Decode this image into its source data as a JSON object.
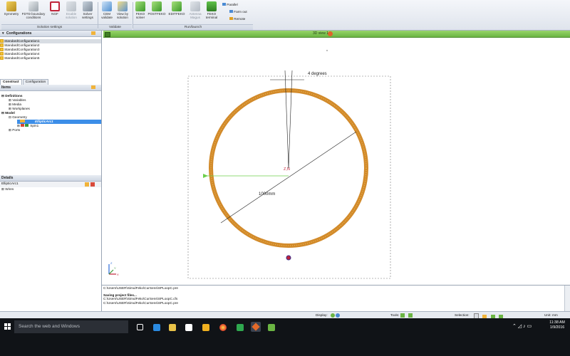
{
  "ribbon": {
    "buttons": [
      {
        "label": "Symmetry",
        "sub": ""
      },
      {
        "label": "FDTD boundary",
        "sub": "conditions"
      },
      {
        "label": "NGF",
        "sub": ""
      },
      {
        "label": "Enable",
        "sub": "solution"
      },
      {
        "label": "Solver",
        "sub": "settings"
      },
      {
        "label": "CEM",
        "sub": "validate"
      },
      {
        "label": "View by",
        "sub": "solution"
      },
      {
        "label": "FEKO",
        "sub": "solver"
      },
      {
        "label": "POSTFEKO",
        "sub": ""
      },
      {
        "label": "EDITFEKO",
        "sub": ""
      },
      {
        "label": "Antenna",
        "sub": "Magus"
      },
      {
        "label": "FEKO",
        "sub": "terminal"
      }
    ],
    "run_options": {
      "parallel": "Parallel",
      "farm_out": "Farm out",
      "remote": "Remote"
    },
    "groups": {
      "solution_settings": "Solution settings",
      "validate": "Validate",
      "run_launch": "Run/launch"
    }
  },
  "configurations": {
    "title": "Configurations",
    "items": [
      "StandardConfiguration1",
      "StandardConfiguration2",
      "StandardConfiguration3",
      "StandardConfiguration4",
      "StandardConfiguration5"
    ],
    "selected_index": 0
  },
  "tree_panel": {
    "tabs": [
      "Construct",
      "Configuration"
    ],
    "header": "Items",
    "nodes": [
      "Definitions",
      "Variables",
      "Media",
      "Workplanes",
      "Model",
      "Geometry",
      "EllipticArc1",
      "Spin1",
      "Ports"
    ]
  },
  "details": {
    "title": "Details",
    "object": "EllipticArc1",
    "child": "Wires"
  },
  "view": {
    "title": "3D view 1",
    "angle_label": "4 degrees",
    "dimension_label": "1000mm",
    "axis_label": "Z,N",
    "triad_x": "X",
    "triad_y": "Y",
    "triad_z": "Z"
  },
  "messages": {
    "lines": [
      "C:\\Users\\USER\\SimulFeko\\CurSens\\SPLoopC.pre",
      "Saving project files...",
      "C:\\Users\\USER\\SimulFeko\\CurSens\\SPLoopC.cfs",
      "C:\\Users\\USER\\SimulFeko\\CurSens\\SPLoopC.pre"
    ]
  },
  "statusbar": {
    "display": "Display:",
    "tools": "Tools:",
    "selection": "Selection:",
    "unit": "Unit: mm"
  },
  "taskbar": {
    "search_placeholder": "Search the web and Windows",
    "time": "11:38 AM",
    "date": "1/9/2016"
  },
  "colors": {
    "loop": "#d28a2a",
    "accent_green": "#7cc64f",
    "selection_blue": "#3c8ee8"
  }
}
